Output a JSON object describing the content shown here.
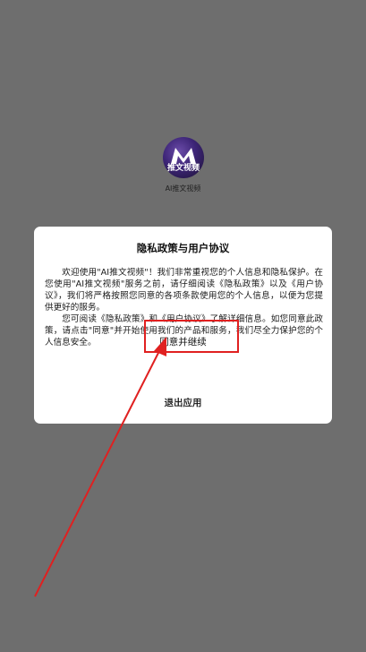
{
  "app": {
    "logo_text": "推文视频",
    "name": "AI推文视频"
  },
  "dialog": {
    "title": "隐私政策与用户协议",
    "paragraph1": "欢迎使用\"AI推文视频\"！我们非常重视您的个人信息和隐私保护。在您使用\"AI推文视频\"服务之前，请仔细阅读《隐私政策》以及《用户协议》，我们将严格按照您同意的各项条款使用您的个人信息，以便为您提供更好的服务。",
    "paragraph2": "您可阅读《隐私政策》和《用户协议》了解详细信息。如您同意此政策，请点击\"同意\"并开始使用我们的产品和服务，我们尽全力保护您的个人信息安全。",
    "agree_label": "同意并继续",
    "exit_label": "退出应用"
  },
  "annotations": {
    "highlight_color": "#e02020",
    "arrow_color": "#e02020"
  }
}
